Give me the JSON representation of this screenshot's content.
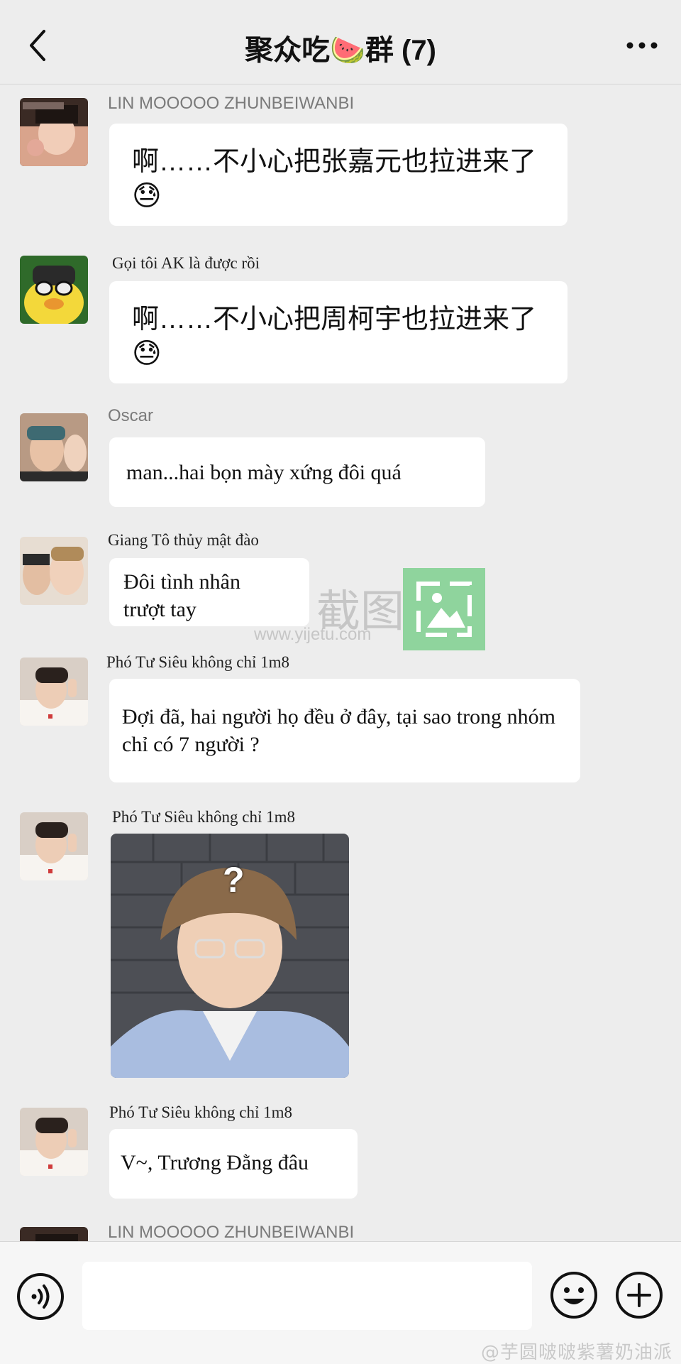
{
  "header": {
    "title": "聚众吃🍉群 (7)"
  },
  "messages": [
    {
      "sender": "LIN MOOOOO ZHUNBEIWANBI",
      "text": "啊……不小心把张嘉元也拉进来了",
      "emoji": "😓"
    },
    {
      "sender": "Gọi tôi AK là được rồi",
      "text": "啊……不小心把周柯宇也拉进来了",
      "emoji": "😓"
    },
    {
      "sender": "Oscar",
      "text": "man...hai bọn mày xứng đôi quá"
    },
    {
      "sender": "Giang Tô thủy mật đào",
      "text_line1": "Đôi tình nhân",
      "text_line2": "trượt tay"
    },
    {
      "sender": "Phó Tư Siêu không chỉ 1m8",
      "text": "Đợi đã, hai người họ đều ở đây, tại sao trong nhóm chỉ có 7 người ?"
    },
    {
      "sender": "Phó Tư Siêu không chỉ 1m8",
      "image": "photo-reaction",
      "overlay": "?"
    },
    {
      "sender": "Phó Tư Siêu không chỉ 1m8",
      "text": "V~, Trương Đằng đâu"
    },
    {
      "sender": "LIN MOOOOO ZHUNBEIWANBI"
    }
  ],
  "watermark": {
    "text": "截图",
    "url": "www.yijetu.com"
  },
  "inputbar": {
    "placeholder": ""
  },
  "credit": "@芋圆啵啵紫薯奶油派",
  "colors": {
    "background": "#ededed",
    "bubble": "#ffffff",
    "watermark_green": "#7fcf8f"
  }
}
